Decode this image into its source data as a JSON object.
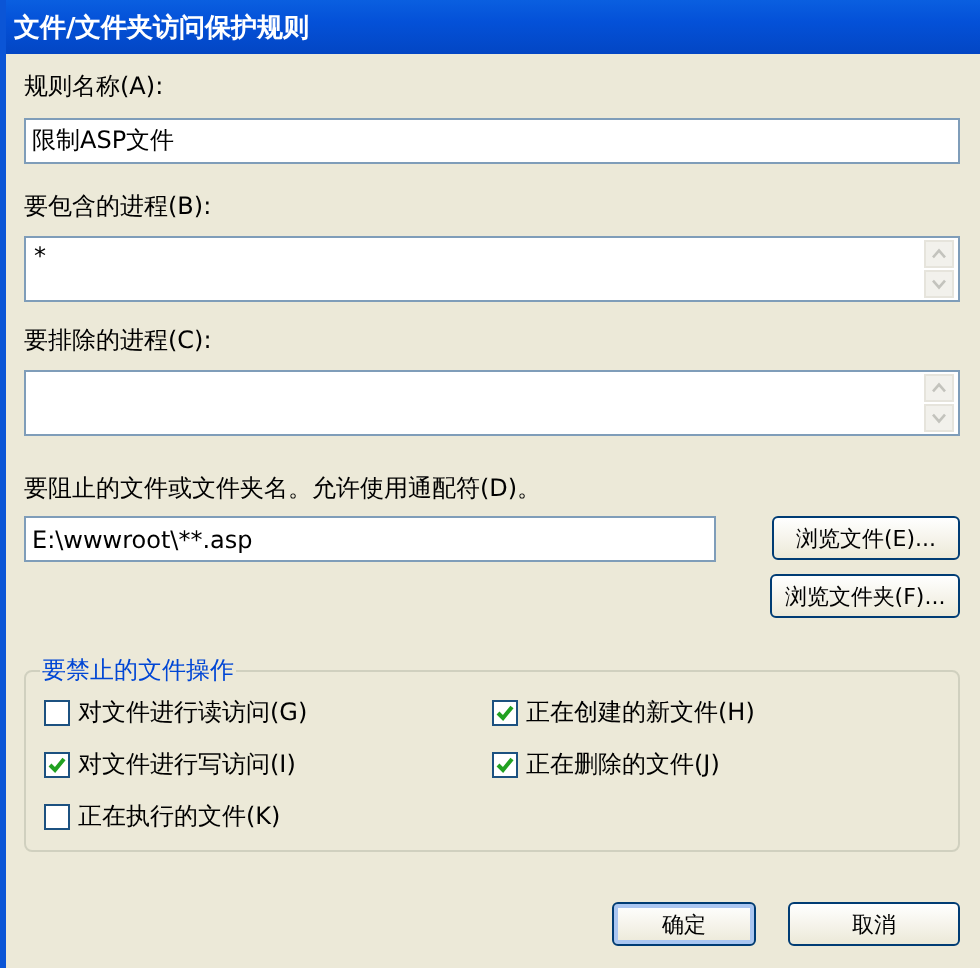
{
  "window": {
    "title": "文件/文件夹访问保护规则"
  },
  "rule_name": {
    "label": "规则名称(A):",
    "value": "限制ASP文件"
  },
  "include_processes": {
    "label": "要包含的进程(B):",
    "value": "*"
  },
  "exclude_processes": {
    "label": "要排除的进程(C):"
  },
  "blocked_path": {
    "label": "要阻止的文件或文件夹名。允许使用通配符(D)。",
    "value": "E:\\wwwroot\\**.asp"
  },
  "browse_buttons": [
    "浏览文件(E)...",
    "浏览文件夹(F)..."
  ],
  "operations": {
    "title": "要禁止的文件操作",
    "items": [
      {
        "label": "对文件进行读访问(G)",
        "checked": false
      },
      {
        "label": "正在创建的新文件(H)",
        "checked": true
      },
      {
        "label": "对文件进行写访问(I)",
        "checked": true
      },
      {
        "label": "正在删除的文件(J)",
        "checked": true
      },
      {
        "label": "正在执行的文件(K)",
        "checked": false
      }
    ]
  },
  "buttons": [
    {
      "label": "确定",
      "default": true
    },
    {
      "label": "取消",
      "default": false
    }
  ]
}
